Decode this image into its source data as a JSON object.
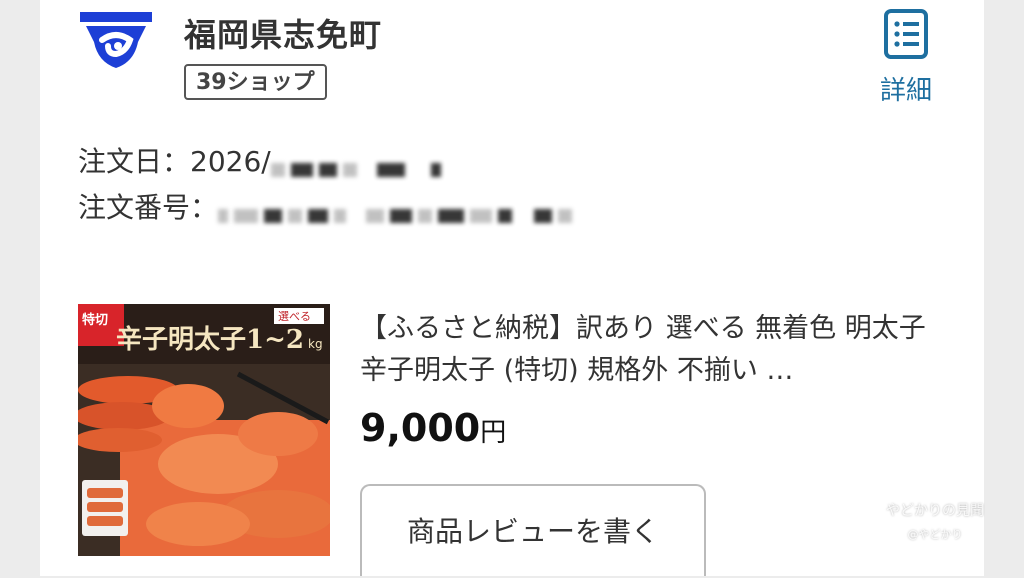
{
  "shop": {
    "name": "福岡県志免町",
    "badge": "39ショップ",
    "logo_icon": "town-emblem-icon"
  },
  "detail": {
    "label": "詳細",
    "icon": "document-list-icon"
  },
  "order": {
    "date_label": "注文日：",
    "date_value_visible": "2026/",
    "number_label": "注文番号："
  },
  "product": {
    "title": "【ふるさと納税】訳あり 選べる 無着色 明太子 辛子明太子 (特切) 規格外 不揃い …",
    "price": "9,000",
    "currency": "円",
    "image_text": {
      "corner_badge": "特切",
      "main": "辛子明太子1~2",
      "unit": "kg",
      "choose": "選べる"
    }
  },
  "review": {
    "button_label": "商品レビューを書く"
  },
  "watermark": {
    "main": "やどかりの見聞",
    "sub": "@やどかり"
  },
  "colors": {
    "emblem_blue": "#1d3fd6",
    "link_blue": "#1e6fa0",
    "background": "#ececec",
    "card": "#ffffff"
  }
}
